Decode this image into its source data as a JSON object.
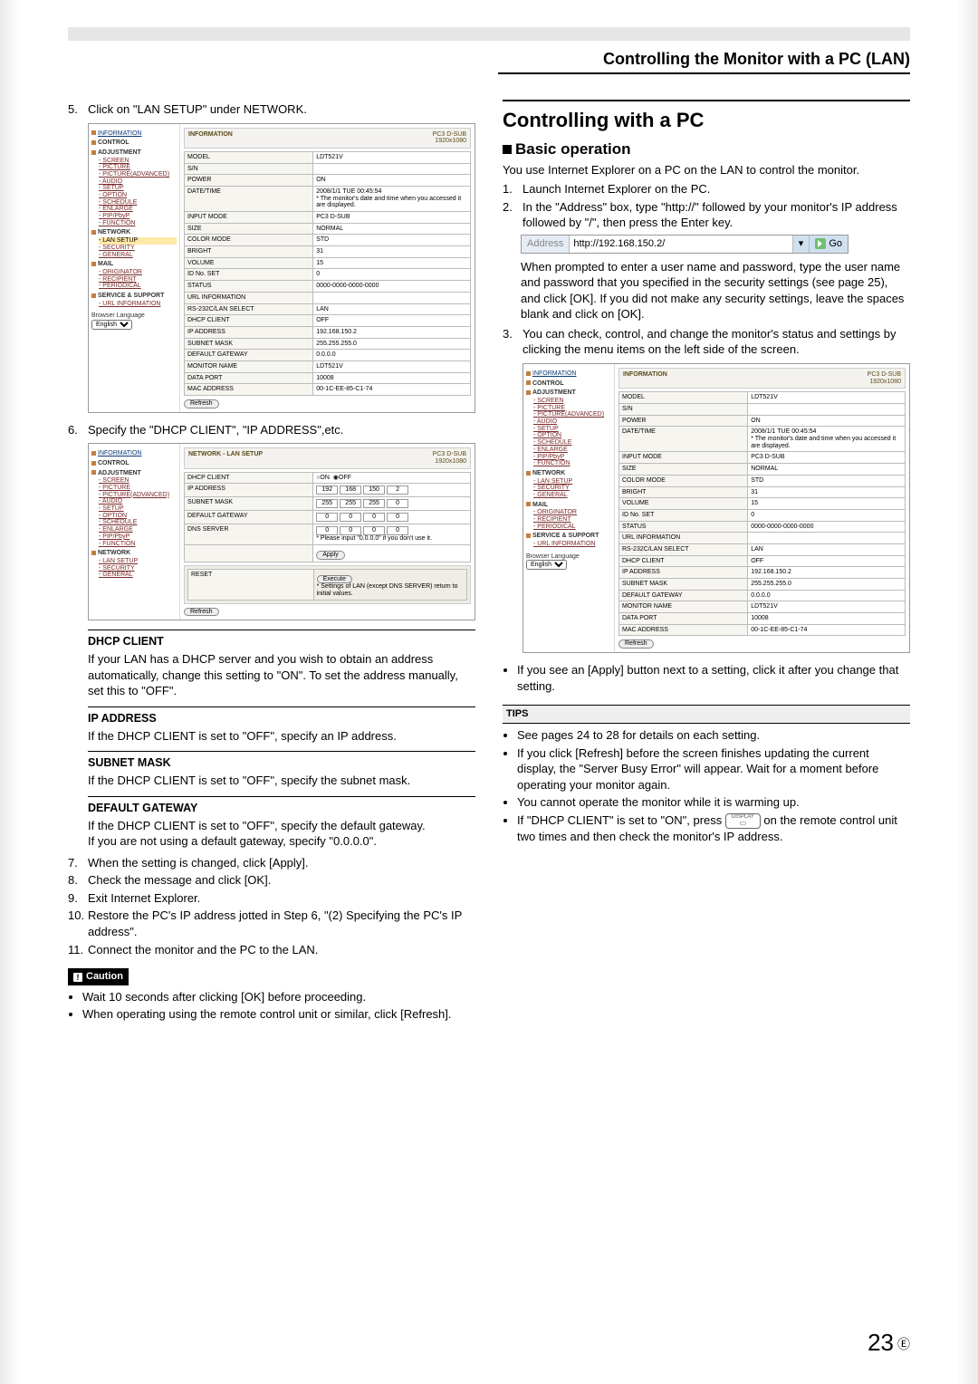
{
  "header": {
    "title": "Controlling the Monitor with a PC (LAN)"
  },
  "left": {
    "step5": "Click on \"LAN SETUP\" under NETWORK.",
    "step6": "Specify the \"DHCP CLIENT\", \"IP ADDRESS\",etc.",
    "step7": "When the setting is changed, click [Apply].",
    "step8": "Check the message and click [OK].",
    "step9": "Exit Internet Explorer.",
    "step10": "Restore the PC's IP address jotted in Step 6, \"(2) Specifying the PC's IP address\".",
    "step11": "Connect the monitor and the PC to the LAN.",
    "sect": {
      "dhcp": {
        "h": "DHCP CLIENT",
        "b": "If your LAN has a DHCP server and you wish to obtain an address automatically, change this setting to \"ON\". To set the address manually, set this to \"OFF\"."
      },
      "ip": {
        "h": "IP ADDRESS",
        "b": "If the DHCP CLIENT is set to \"OFF\", specify an IP address."
      },
      "mask": {
        "h": "SUBNET MASK",
        "b": "If the DHCP CLIENT is set to \"OFF\", specify the subnet mask."
      },
      "gw": {
        "h": "DEFAULT GATEWAY",
        "b1": "If the DHCP CLIENT is set to \"OFF\", specify the default gateway.",
        "b2": "If you are not using a default gateway, specify \"0.0.0.0\"."
      }
    },
    "caution": {
      "label": "Caution",
      "items": [
        "Wait 10 seconds after clicking [OK] before proceeding.",
        "When operating using the remote control unit or similar, click [Refresh]."
      ]
    }
  },
  "right": {
    "h1": "Controlling with a PC",
    "h2": "Basic operation",
    "intro": "You use Internet Explorer on a PC on the LAN  to control the monitor.",
    "step1": "Launch Internet Explorer on the PC.",
    "step2": "In the \"Address\" box, type \"http://\" followed by your monitor's IP address followed by \"/\", then press the Enter key.",
    "addr": {
      "label": "Address",
      "url": "http://192.168.150.2/",
      "go": "Go"
    },
    "step2b": "When prompted to enter a user name and password, type the user name and password that you specified in the security settings (see page 25), and click [OK]. If you did not make any security settings, leave the spaces blank and click on [OK].",
    "step3": "You can check, control, and change the monitor's status and settings by clicking the menu items on the left side of the screen.",
    "apply_note": "If you see an [Apply] button next to a setting, click it after you change that setting.",
    "tips_h": "TIPS",
    "tips": [
      "See pages 24 to 28 for details on each setting.",
      "If you click [Refresh] before the screen finishes updating the current display, the \"Server Busy Error\" will appear. Wait for a moment before operating your monitor again.",
      "You cannot operate the monitor while it is warming up."
    ],
    "tip_dhcp_a": "If \"DHCP CLIENT\" is set to \"ON\", press ",
    "tip_dhcp_b": " on the remote control unit two times and then check the monitor's IP address.",
    "display_btn": "DISPLAY"
  },
  "sidebar": {
    "information": "INFORMATION",
    "control": "CONTROL",
    "adjustment": "ADJUSTMENT",
    "adj_items": [
      "SCREEN",
      "PICTURE",
      "PICTURE(ADVANCED)",
      "AUDIO",
      "SETUP",
      "OPTION",
      "SCHEDULE",
      "ENLARGE",
      "PIP/PbyP",
      "FUNCTION"
    ],
    "network": "NETWORK",
    "net_items": [
      "LAN SETUP",
      "SECURITY",
      "GENERAL"
    ],
    "mail": "MAIL",
    "mail_items": [
      "ORIGINATOR",
      "RECIPIENT",
      "PERIODICAL"
    ],
    "service": "SERVICE & SUPPORT",
    "svc_items": [
      "URL INFORMATION"
    ],
    "lang_label": "Browser Language",
    "lang_value": "English",
    "refresh": "Refresh"
  },
  "info_panel": {
    "title": "INFORMATION",
    "badge1": "PC3 D-SUB",
    "badge2": "1920x1080",
    "rows": [
      [
        "MODEL",
        "LDT521V"
      ],
      [
        "S/N",
        ""
      ],
      [
        "POWER",
        "ON"
      ],
      [
        "DATE/TIME",
        "2008/1/1 TUE 00:45:54\n* The monitor's date and time when you accessed it are displayed."
      ],
      [
        "INPUT MODE",
        "PC3 D-SUB"
      ],
      [
        "SIZE",
        "NORMAL"
      ],
      [
        "COLOR MODE",
        "STD"
      ],
      [
        "BRIGHT",
        "31"
      ],
      [
        "VOLUME",
        "15"
      ],
      [
        "ID No. SET",
        "0"
      ],
      [
        "STATUS",
        "0000-0000-0000-0000"
      ],
      [
        "URL INFORMATION",
        ""
      ],
      [
        "RS-232C/LAN SELECT",
        "LAN"
      ],
      [
        "DHCP CLIENT",
        "OFF"
      ],
      [
        "IP ADDRESS",
        "192.168.150.2"
      ],
      [
        "SUBNET MASK",
        "255.255.255.0"
      ],
      [
        "DEFAULT GATEWAY",
        "0.0.0.0"
      ],
      [
        "MONITOR NAME",
        "LDT521V"
      ],
      [
        "DATA PORT",
        "10008"
      ],
      [
        "MAC ADDRESS",
        "00-1C-EE-85-C1-74"
      ]
    ]
  },
  "lan_panel": {
    "title": "NETWORK - LAN SETUP",
    "badge1": "PC3 D-SUB",
    "badge2": "1920x1080",
    "dhcp_label": "DHCP CLIENT",
    "dhcp_on": "ON",
    "dhcp_off": "OFF",
    "ip_label": "IP ADDRESS",
    "ip": [
      "192",
      "168",
      "150",
      "2"
    ],
    "mask_label": "SUBNET MASK",
    "mask": [
      "255",
      "255",
      "255",
      "0"
    ],
    "gw_label": "DEFAULT GATEWAY",
    "gw": [
      "0",
      "0",
      "0",
      "0"
    ],
    "dns_label": "DNS SERVER",
    "dns": [
      "0",
      "0",
      "0",
      "0"
    ],
    "dns_note": "* Please input \"0.0.0.0\" if you don't use it.",
    "apply": "Apply",
    "reset_label": "RESET",
    "execute": "Execute",
    "reset_note": "* Settings of LAN (except DNS SERVER) return to initial values."
  },
  "page_number": "23",
  "page_suffix": "E"
}
